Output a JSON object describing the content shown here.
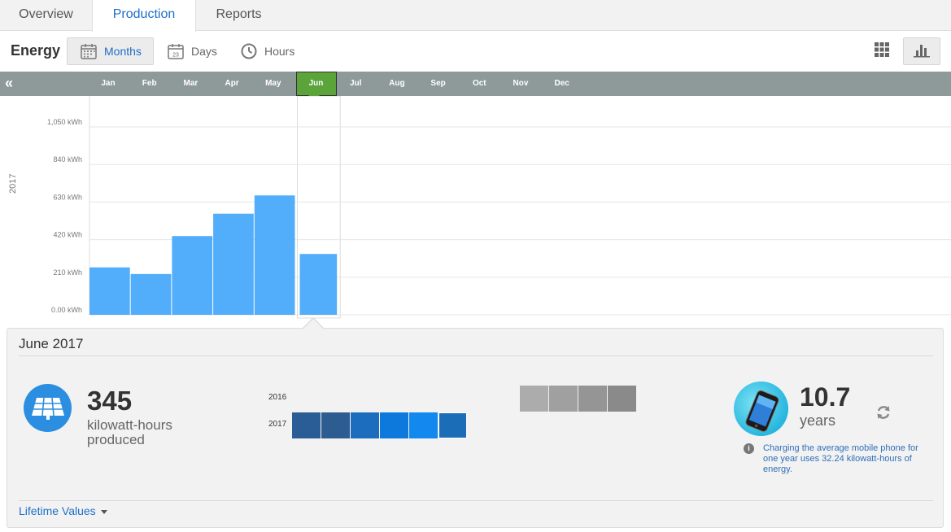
{
  "tabs": [
    {
      "label": "Overview",
      "active": false
    },
    {
      "label": "Production",
      "active": true
    },
    {
      "label": "Reports",
      "active": false
    }
  ],
  "toolbar": {
    "title": "Energy",
    "modes": [
      {
        "label": "Months",
        "icon": "calendar-icon",
        "active": true
      },
      {
        "label": "Days",
        "icon": "calendar-day-icon",
        "day_number": "23",
        "active": false
      },
      {
        "label": "Hours",
        "icon": "clock-icon",
        "active": false
      }
    ],
    "views": [
      {
        "icon": "grid-view-icon",
        "active": false
      },
      {
        "icon": "bar-chart-view-icon",
        "active": true
      }
    ]
  },
  "month_strip": {
    "back_icon": "double-chevron-left-icon",
    "back_glyph": "«",
    "months": [
      "Jan",
      "Feb",
      "Mar",
      "Apr",
      "May",
      "Jun",
      "Jul",
      "Aug",
      "Sep",
      "Oct",
      "Nov",
      "Dec"
    ],
    "selected": "Jun"
  },
  "chart_data": {
    "type": "bar",
    "ylabel": "2017",
    "ylim": [
      0,
      1050
    ],
    "yticks": [
      "0.00 kWh",
      "210 kWh",
      "420 kWh",
      "630 kWh",
      "840 kWh",
      "1,050 kWh"
    ],
    "ytick_values": [
      0,
      210,
      420,
      630,
      840,
      1050
    ],
    "categories": [
      "Jan",
      "Feb",
      "Mar",
      "Apr",
      "May",
      "Jun"
    ],
    "values": [
      265,
      228,
      440,
      565,
      667,
      340
    ],
    "bar_color": "#52adfb",
    "highlight_category": "Jun",
    "grid": true
  },
  "details": {
    "title": "June 2017",
    "produced_value": "345",
    "produced_unit": "kilowatt-hours produced",
    "produced_icon": "solar-panel-icon",
    "comparison": {
      "years": [
        "2016",
        "2017"
      ],
      "gray_cells": [
        "#acacac",
        "#a0a0a0",
        "#959595",
        "#8a8a8a"
      ],
      "blue_cells": [
        "#2a5d96",
        "#2d5d90",
        "#1c6dbd",
        "#0e79dc",
        "#1388ee",
        "#1a6db6"
      ]
    },
    "equivalent_value": "10.7",
    "equivalent_unit": "years",
    "equivalent_icon": "mobile-phone-icon",
    "refresh_icon": "refresh-icon",
    "info_icon": "info-icon",
    "info_text": "Charging the average mobile phone for one year uses 32.24 kilowatt-hours of energy.",
    "lifetime_label": "Lifetime Values"
  },
  "colors": {
    "accent": "#1e6ec8",
    "month_strip": "#8d9a99",
    "selected_month": "#5aa43a",
    "solar_circle": "#2c8ee0"
  }
}
